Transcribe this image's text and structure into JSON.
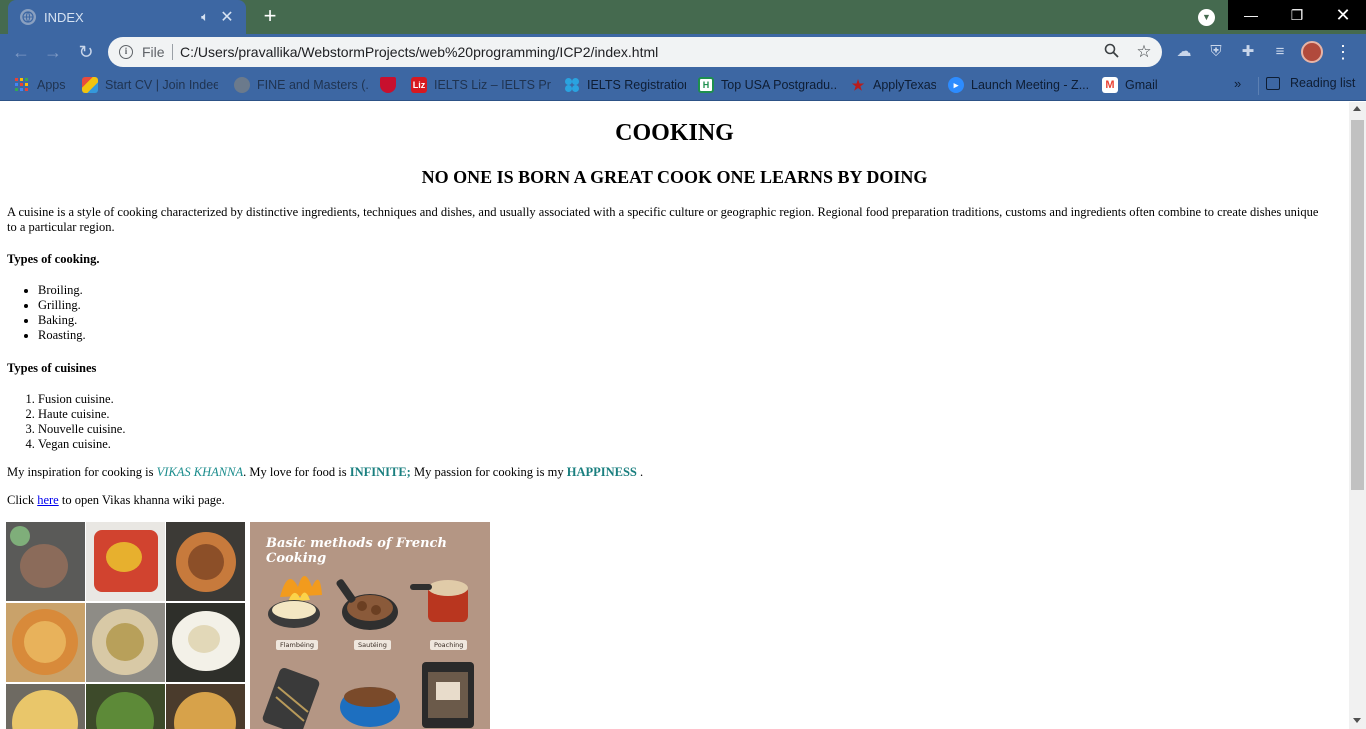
{
  "browser": {
    "tab": {
      "title": "INDEX",
      "audio_icon": "speaker-icon",
      "close_icon": "close-icon"
    },
    "new_tab_icon": "plus-icon",
    "window_controls": {
      "minimize": "minimize-icon",
      "maximize": "restore-icon",
      "close": "close-icon"
    },
    "toolbar": {
      "scheme_label": "File",
      "url": "C:/Users/pravallika/WebstormProjects/web%20programming/ICP2/index.html"
    },
    "bookmarks": [
      {
        "label": "Apps",
        "icon": "apps-grid-icon",
        "color": "#4285f4"
      },
      {
        "label": "Start CV | Join Indee...",
        "icon": "colorful-squares-icon",
        "color": "#e84c3d"
      },
      {
        "label": "FINE and Masters (...",
        "icon": "globe-icon",
        "color": "#6b7a8c"
      },
      {
        "label": "",
        "icon": "shield-crest-icon",
        "color": "#c8102e"
      },
      {
        "label": "IELTS Liz – IELTS Pre...",
        "icon": "liz-icon",
        "color": "#d71920"
      },
      {
        "label": "IELTS Registration",
        "icon": "clover-icon",
        "color": "#2aa3e0"
      },
      {
        "label": "Top USA Postgradu...",
        "icon": "h-logo-icon",
        "color": "#1e8f4e"
      },
      {
        "label": "ApplyTexas",
        "icon": "star-icon",
        "color": "#b71c1c"
      },
      {
        "label": "Launch Meeting - Z...",
        "icon": "zoom-video-icon",
        "color": "#2d8cff"
      },
      {
        "label": "Gmail",
        "icon": "gmail-icon",
        "color": "#ea4335"
      }
    ],
    "reading_list_label": "Reading list"
  },
  "page": {
    "heading": "COOKING",
    "subheading": "NO ONE IS BORN A GREAT COOK ONE LEARNS BY DOING",
    "intro": "A cuisine is a style of cooking characterized by distinctive ingredients, techniques and dishes, and usually associated with a specific culture or geographic region. Regional food preparation traditions, customs and ingredients often combine to create dishes unique to a particular region.",
    "cooking_types_title": "Types of cooking.",
    "cooking_types": [
      "Broiling.",
      "Grilling.",
      "Baking.",
      "Roasting."
    ],
    "cuisine_types_title": "Types of cuisines",
    "cuisine_types": [
      "Fusion cuisine.",
      "Haute cuisine.",
      "Nouvelle cuisine.",
      "Vegan cuisine."
    ],
    "inspiration": {
      "prefix": "My inspiration for cooking is ",
      "chef": "VIKAS KHANNA",
      "middle1": ". My love for food is ",
      "love": "INFINITE;",
      "middle2": " My passion for cooking is my ",
      "passion": "HAPPINESS",
      "suffix": " ."
    },
    "click_line": {
      "prefix": "Click ",
      "link": "here",
      "suffix": " to open Vikas khanna wiki page."
    },
    "french_image": {
      "title": "Basic methods of French Cooking",
      "methods": [
        "Flambéing",
        "Sautéing",
        "Poaching"
      ]
    }
  },
  "colors": {
    "tabstrip": "#456a4f",
    "toolbar": "#3d67a3",
    "accent_teal": "#1a8c8c",
    "link": "#0000ee"
  }
}
